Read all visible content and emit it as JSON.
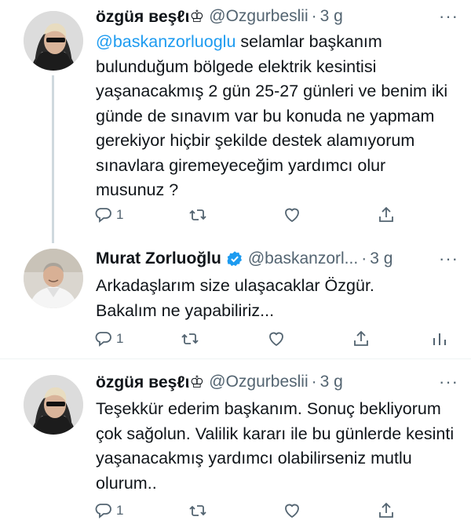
{
  "tweets": [
    {
      "name": "özgüя вeşℓι♔",
      "handle": "@Ozgurbeslii",
      "dot": "·",
      "time": "3 g",
      "mention": "@baskanzorluoglu",
      "text": " selamlar başkanım bulunduğum bölgede elektrik kesintisi yaşanacakmış 2 gün 25-27 günleri ve benim iki günde de sınavım var bu konuda ne yapmam gerekiyor hiçbir şekilde destek alamıyorum sınavlara giremeyeceğim yardımcı olur musunuz ?",
      "reply_count": "1",
      "icons": [
        "reply-icon",
        "retweet-icon",
        "like-icon",
        "share-icon"
      ]
    },
    {
      "name": "Murat Zorluoğlu",
      "verified": true,
      "handle": "@baskanzorl...",
      "dot": "·",
      "time": "3 g",
      "text": "Arkadaşlarım size ulaşacaklar Özgür. Bakalım ne yapabiliriz...",
      "reply_count": "1",
      "icons": [
        "reply-icon",
        "retweet-icon",
        "like-icon",
        "share-icon",
        "analytics-icon"
      ]
    },
    {
      "name": "özgüя вeşℓι♔",
      "handle": "@Ozgurbeslii",
      "dot": "·",
      "time": "3 g",
      "text": "Teşekkür ederim başkanım. Sonuç bekliyorum çok sağolun. Valilik kararı ile bu günlerde kesinti yaşanacakmış yardımcı olabilirseniz mutlu olurum..",
      "reply_count": "1",
      "icons": [
        "reply-icon",
        "retweet-icon",
        "like-icon",
        "share-icon"
      ]
    }
  ],
  "more_label": "···",
  "colors": {
    "accent": "#1d9bf0",
    "muted": "#536471",
    "line": "#cfd9de"
  }
}
